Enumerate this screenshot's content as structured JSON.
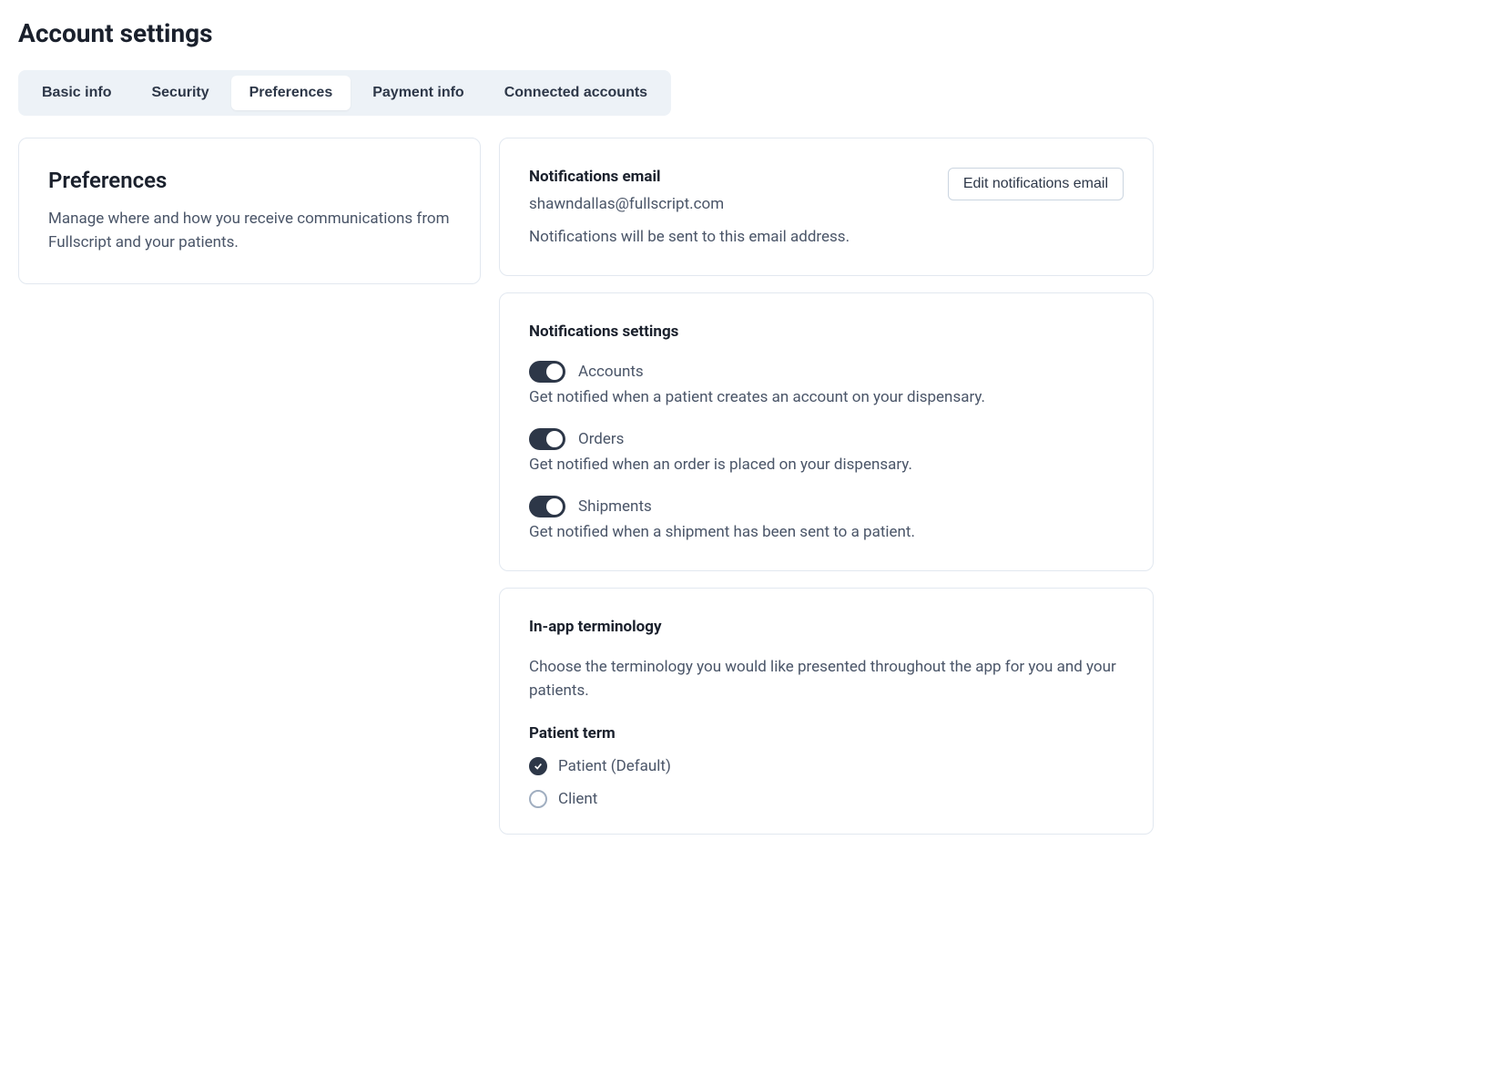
{
  "page": {
    "title": "Account settings"
  },
  "tabs": [
    {
      "label": "Basic info",
      "active": false
    },
    {
      "label": "Security",
      "active": false
    },
    {
      "label": "Preferences",
      "active": true
    },
    {
      "label": "Payment info",
      "active": false
    },
    {
      "label": "Connected accounts",
      "active": false
    }
  ],
  "preferences_card": {
    "title": "Preferences",
    "description": "Manage where and how you receive communications from Fullscript and your patients."
  },
  "notifications_email": {
    "title": "Notifications email",
    "email": "shawndallas@fullscript.com",
    "description": "Notifications will be sent to this email address.",
    "edit_button": "Edit notifications email"
  },
  "notifications_settings": {
    "title": "Notifications settings",
    "items": [
      {
        "label": "Accounts",
        "description": "Get notified when a patient creates an account on your dispensary.",
        "enabled": true
      },
      {
        "label": "Orders",
        "description": "Get notified when an order is placed on your dispensary.",
        "enabled": true
      },
      {
        "label": "Shipments",
        "description": "Get notified when a shipment has been sent to a patient.",
        "enabled": true
      }
    ]
  },
  "terminology": {
    "title": "In-app terminology",
    "description": "Choose the terminology you would like presented throughout the app for you and your patients.",
    "subsection_title": "Patient term",
    "options": [
      {
        "label": "Patient (Default)",
        "selected": true
      },
      {
        "label": "Client",
        "selected": false
      }
    ]
  }
}
